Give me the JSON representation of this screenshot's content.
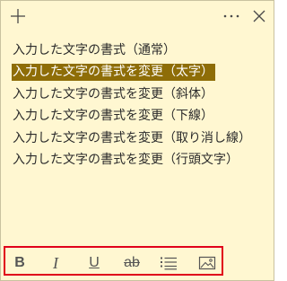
{
  "titlebar": {
    "add_icon": "plus-icon",
    "more_label": "⋯",
    "close_label": "×"
  },
  "note": {
    "lines": [
      "入力した文字の書式（通常）",
      "入力した文字の書式を変更（太字）",
      "入力した文字の書式を変更（斜体）",
      "入力した文字の書式を変更（下線）",
      "入力した文字の書式を変更（取り消し線）",
      "入力した文字の書式を変更（行頭文字）"
    ],
    "selected_index": 1
  },
  "toolbar": {
    "bold_label": "B",
    "italic_label": "I",
    "underline_label": "U",
    "strike_label": "ab",
    "list_icon": "bullet-list-icon",
    "image_icon": "image-icon"
  },
  "colors": {
    "note_background": "#fff7d1",
    "selection": "#8e6d07",
    "highlight_border": "#e0001b"
  }
}
